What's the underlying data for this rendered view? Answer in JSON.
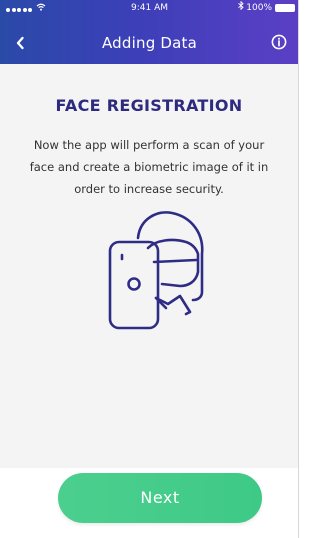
{
  "status_bar": {
    "time": "9:41 AM",
    "battery_percent": "100%"
  },
  "nav": {
    "title": "Adding Data",
    "back_icon": "chevron-left-icon",
    "info_icon": "info-circle-icon"
  },
  "content": {
    "heading": "FACE REGISTRATION",
    "description": "Now the app will perform a scan of your face and create a biometric image of it in order to increase security.",
    "illustration_icon": "face-phone-scan-icon"
  },
  "actions": {
    "next_label": "Next"
  },
  "colors": {
    "header_gradient_start": "#2a4aa8",
    "header_gradient_end": "#5b3fc5",
    "heading": "#2e2a7e",
    "illustration_stroke": "#2f2c86",
    "button": "#45cc8a"
  }
}
